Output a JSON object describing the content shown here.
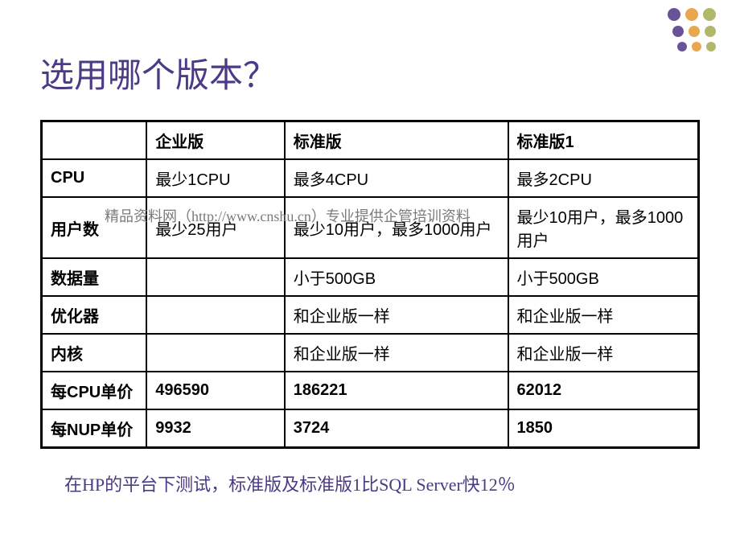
{
  "title": "选用哪个版本？",
  "watermark": "精品资料网（http://www.cnshu.cn）专业提供企管培训资料",
  "table": {
    "headers": {
      "col0": "",
      "col1": "企业版",
      "col2": "标准版",
      "col3": "标准版1"
    },
    "rows": {
      "cpu": {
        "label": "CPU",
        "c1": "最少1CPU",
        "c2": "最多4CPU",
        "c3": "最多2CPU"
      },
      "users": {
        "label": "用户数",
        "c1": "最少25用户",
        "c2": "最少10用户，最多1000用户",
        "c3": "最少10用户，最多1000用户"
      },
      "data": {
        "label": "数据量",
        "c1": "",
        "c2": "小于500GB",
        "c3": "小于500GB"
      },
      "optimizer": {
        "label": "优化器",
        "c1": "",
        "c2": "和企业版一样",
        "c3": "和企业版一样"
      },
      "kernel": {
        "label": "内核",
        "c1": "",
        "c2": "和企业版一样",
        "c3": "和企业版一样"
      },
      "cpuprice": {
        "label": "每CPU单价",
        "c1": "496590",
        "c2": "186221",
        "c3": "62012"
      },
      "nupprice": {
        "label": "每NUP单价",
        "c1": "9932",
        "c2": "3724",
        "c3": "1850"
      }
    }
  },
  "footer_note": "在HP的平台下测试，标准版及标准版1比SQL Server快12％",
  "chart_data": {
    "type": "table",
    "title": "选用哪个版本？",
    "columns": [
      "",
      "企业版",
      "标准版",
      "标准版1"
    ],
    "rows": [
      [
        "CPU",
        "最少1CPU",
        "最多4CPU",
        "最多2CPU"
      ],
      [
        "用户数",
        "最少25用户",
        "最少10用户，最多1000用户",
        "最少10用户，最多1000用户"
      ],
      [
        "数据量",
        "",
        "小于500GB",
        "小于500GB"
      ],
      [
        "优化器",
        "",
        "和企业版一样",
        "和企业版一样"
      ],
      [
        "内核",
        "",
        "和企业版一样",
        "和企业版一样"
      ],
      [
        "每CPU单价",
        496590,
        186221,
        62012
      ],
      [
        "每NUP单价",
        9932,
        3724,
        1850
      ]
    ]
  }
}
